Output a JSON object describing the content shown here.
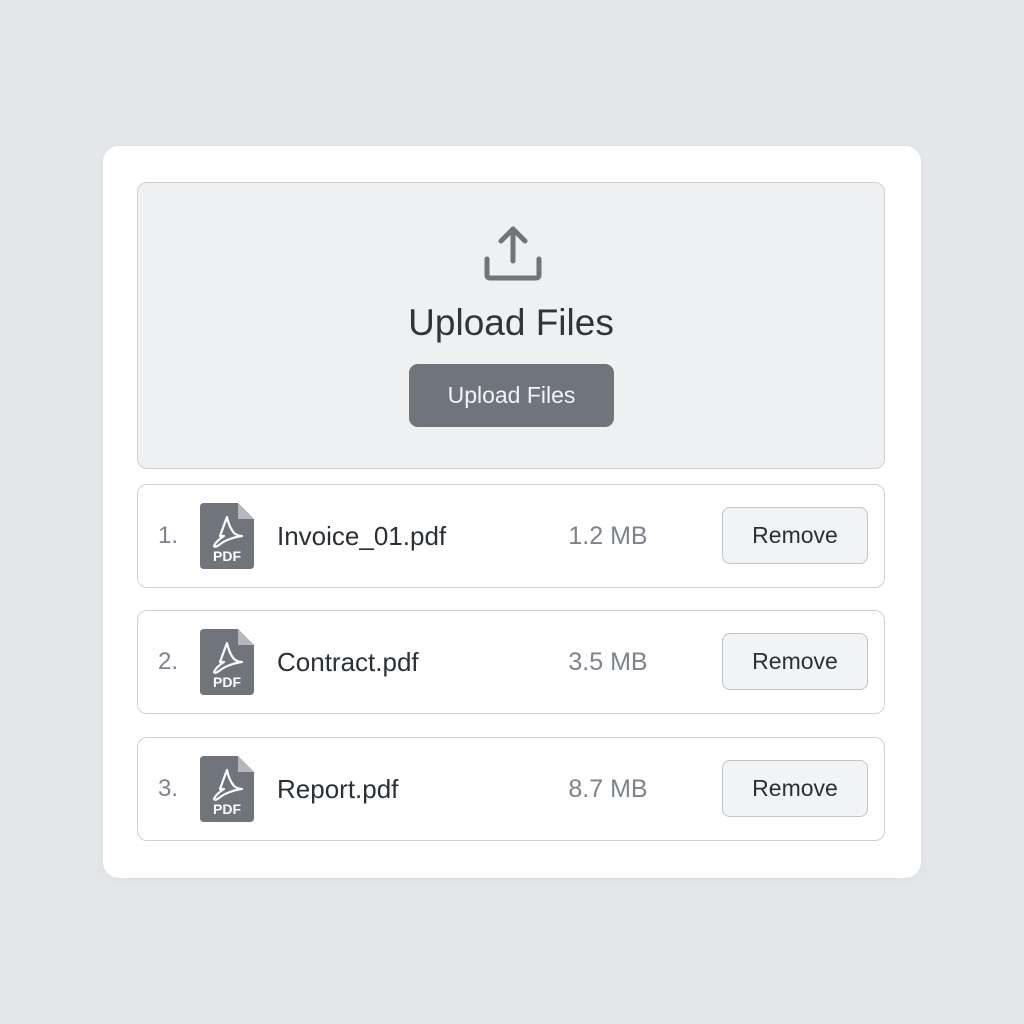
{
  "upload": {
    "title": "Upload Files",
    "button_label": "Upload Files",
    "icon": "upload-icon"
  },
  "files": [
    {
      "index": "1.",
      "name": "Invoice_01.pdf",
      "size": "1.2 MB",
      "type_label": "PDF",
      "action_label": "Remove"
    },
    {
      "index": "2.",
      "name": "Contract.pdf",
      "size": "3.5 MB",
      "type_label": "PDF",
      "action_label": "Remove"
    },
    {
      "index": "3.",
      "name": "Report.pdf",
      "size": "8.7 MB",
      "type_label": "PDF",
      "action_label": "Remove"
    }
  ],
  "colors": {
    "background": "#e4e7e9",
    "card": "#ffffff",
    "dropzone": "#eef0f2",
    "primary_button": "#6f757b",
    "icon": "#6f757b"
  }
}
